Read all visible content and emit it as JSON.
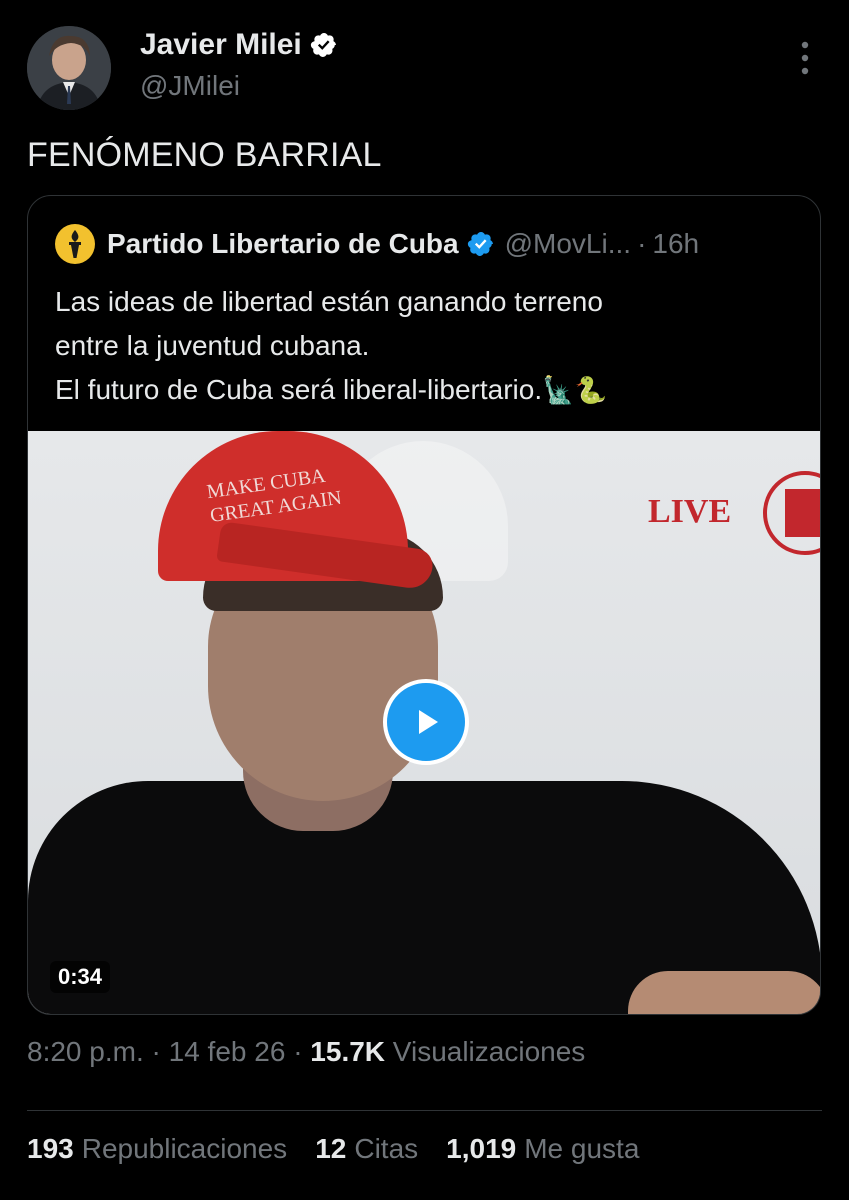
{
  "tweet": {
    "author_name": "Javier Milei",
    "author_handle": "@JMilei",
    "text": "FENÓMENO BARRIAL",
    "time": "8:20 p.m.",
    "date": "14 feb 26",
    "views_count": "15.7K",
    "views_label": "Visualizaciones",
    "separator": "·"
  },
  "quoted": {
    "author_name": "Partido Libertario de Cuba",
    "author_handle": "@MovLi...",
    "separator": "·",
    "time": "16h",
    "lines": [
      "Las ideas de libertad están ganando terreno",
      "entre la juventud cubana.",
      "El futuro de Cuba será liberal-libertario."
    ],
    "emojis": "🗽🐍",
    "video": {
      "duration": "0:34",
      "overlay_live": "LIVE",
      "cap_text_1": "MAKE CUBA",
      "cap_text_2": "GREAT AGAIN"
    }
  },
  "stats": {
    "reposts_count": "193",
    "reposts_label": "Republicaciones",
    "quotes_count": "12",
    "quotes_label": "Citas",
    "likes_count": "1,019",
    "likes_label": "Me gusta"
  },
  "colors": {
    "background": "#000000",
    "text_primary": "#e7e9ea",
    "text_secondary": "#71767b",
    "accent": "#1d9bf0",
    "border": "#2f3336"
  }
}
